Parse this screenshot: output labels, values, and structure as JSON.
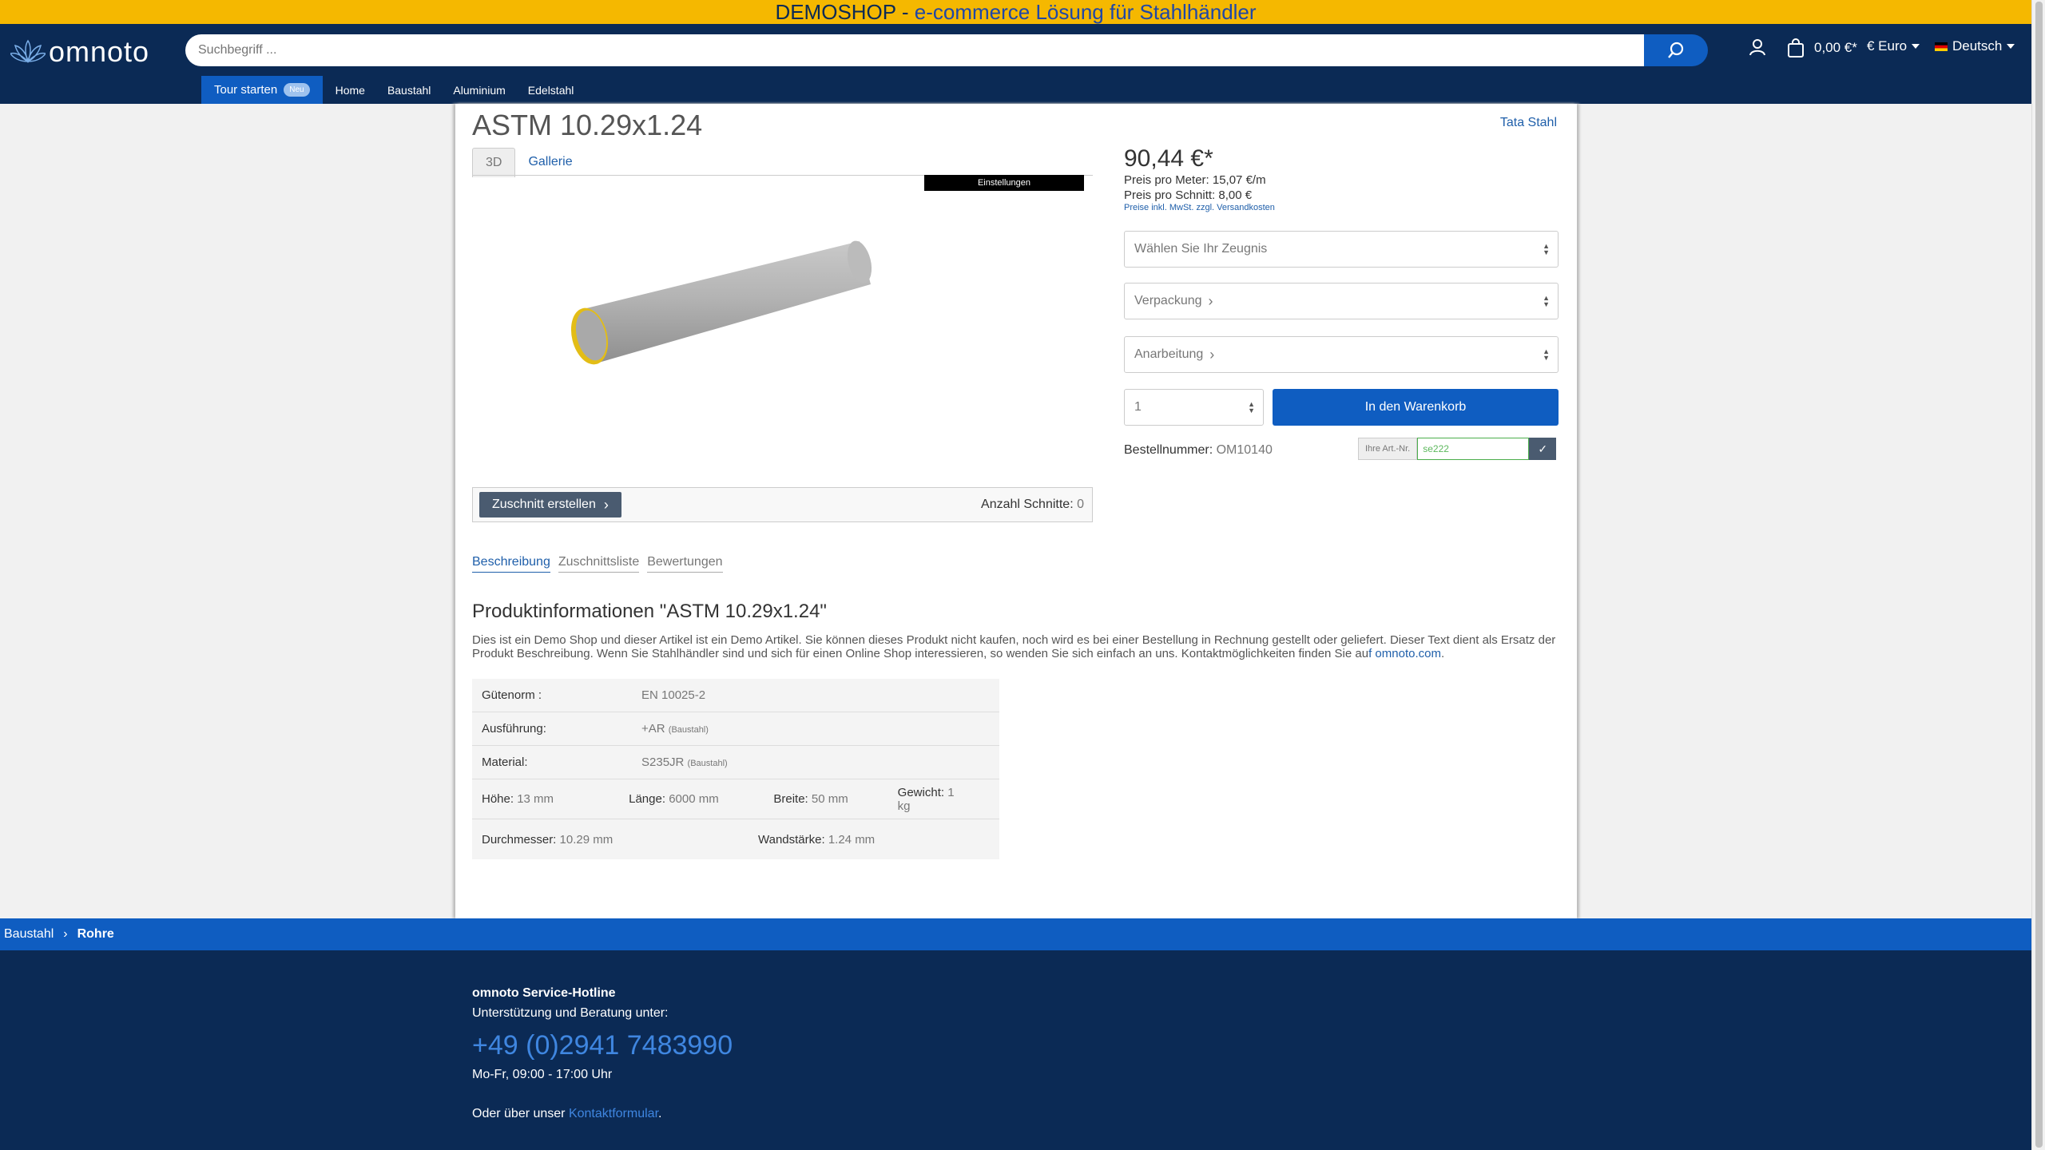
{
  "banner": {
    "part1": "DEMOSHOP - ",
    "part2": "e-commerce Lösung für Stahlhändler"
  },
  "header": {
    "logo_text": "omnoto",
    "search_placeholder": "Suchbegriff ...",
    "cart_total": "0,00 €*",
    "currency": "€  Euro",
    "language": "Deutsch"
  },
  "nav": {
    "tour_label": "Tour starten",
    "tour_badge": "Neu",
    "items": [
      "Home",
      "Baustahl",
      "Aluminium",
      "Edelstahl"
    ]
  },
  "product": {
    "title": "ASTM 10.29x1.24",
    "brand": "Tata Stahl",
    "view_tabs": [
      "3D",
      "Gallerie"
    ],
    "settings_label": "Einstellungen",
    "cut_button": "Zuschnitt erstellen",
    "cuts_label": "Anzahl Schnitte:",
    "cuts_value": "0",
    "price": "90,44 €*",
    "price_per_meter": "Preis pro Meter: 15,07 €/m",
    "price_per_cut": "Preis pro Schnitt: 8,00 €",
    "price_note": "Preise inkl. MwSt. zzgl. Versandkosten",
    "certificate_select": "Wählen Sie Ihr Zeugnis",
    "packaging_select": "Verpackung",
    "processing_select": "Anarbeitung",
    "quantity": "1",
    "cart_button": "In den Warenkorb",
    "order_number_label": "Bestellnummer:",
    "order_number": "OM10140",
    "art_nr_label": "Ihre Art.-Nr.",
    "art_nr_value": "se222"
  },
  "detail_tabs": [
    "Beschreibung",
    "Zuschnittsliste",
    "Bewertungen"
  ],
  "info": {
    "title": "Produktinformationen \"ASTM 10.29x1.24\"",
    "description": "Dies ist ein Demo Shop und dieser Artikel ist ein Demo Artikel. Sie können dieses Produkt nicht kaufen, noch wird es bei einer Bestellung in Rechnung gestellt oder geliefert. Dieser Text dient als Ersatz der Produkt Beschreibung. Wenn Sie Stahlhändler sind und sich für einen Online Shop interessieren, so wenden Sie sich einfach an uns. Kontaktmöglichkeiten finden Sie au",
    "link": "f omnoto.com",
    "end": "."
  },
  "specs": {
    "guetenorm_label": "Gütenorm :",
    "guetenorm": "EN 10025-2",
    "ausfuehrung_label": "Ausführung:",
    "ausfuehrung": "+AR",
    "ausfuehrung_sub": "(Baustahl)",
    "material_label": "Material:",
    "material": "S235JR",
    "material_sub": "(Baustahl)",
    "hoehe_label": "Höhe:",
    "hoehe": "13 mm",
    "laenge_label": "Länge:",
    "laenge": "6000 mm",
    "breite_label": "Breite:",
    "breite": "50 mm",
    "gewicht_label": "Gewicht:",
    "gewicht": "1 kg",
    "durchmesser_label": "Durchmesser:",
    "durchmesser": "10.29 mm",
    "wandstaerke_label": "Wandstärke:",
    "wandstaerke": "1.24 mm"
  },
  "breadcrumb": [
    "Baustahl",
    "Rohre"
  ],
  "footer": {
    "hotline_title": "omnoto Service-Hotline",
    "hotline_sub": "Unterstützung und Beratung unter:",
    "phone": "+49 (0)2941 7483990",
    "hours": "Mo-Fr, 09:00 - 17:00 Uhr",
    "contact_text": "Oder über unser ",
    "contact_link": "Kontaktformular",
    "contact_end": "."
  }
}
